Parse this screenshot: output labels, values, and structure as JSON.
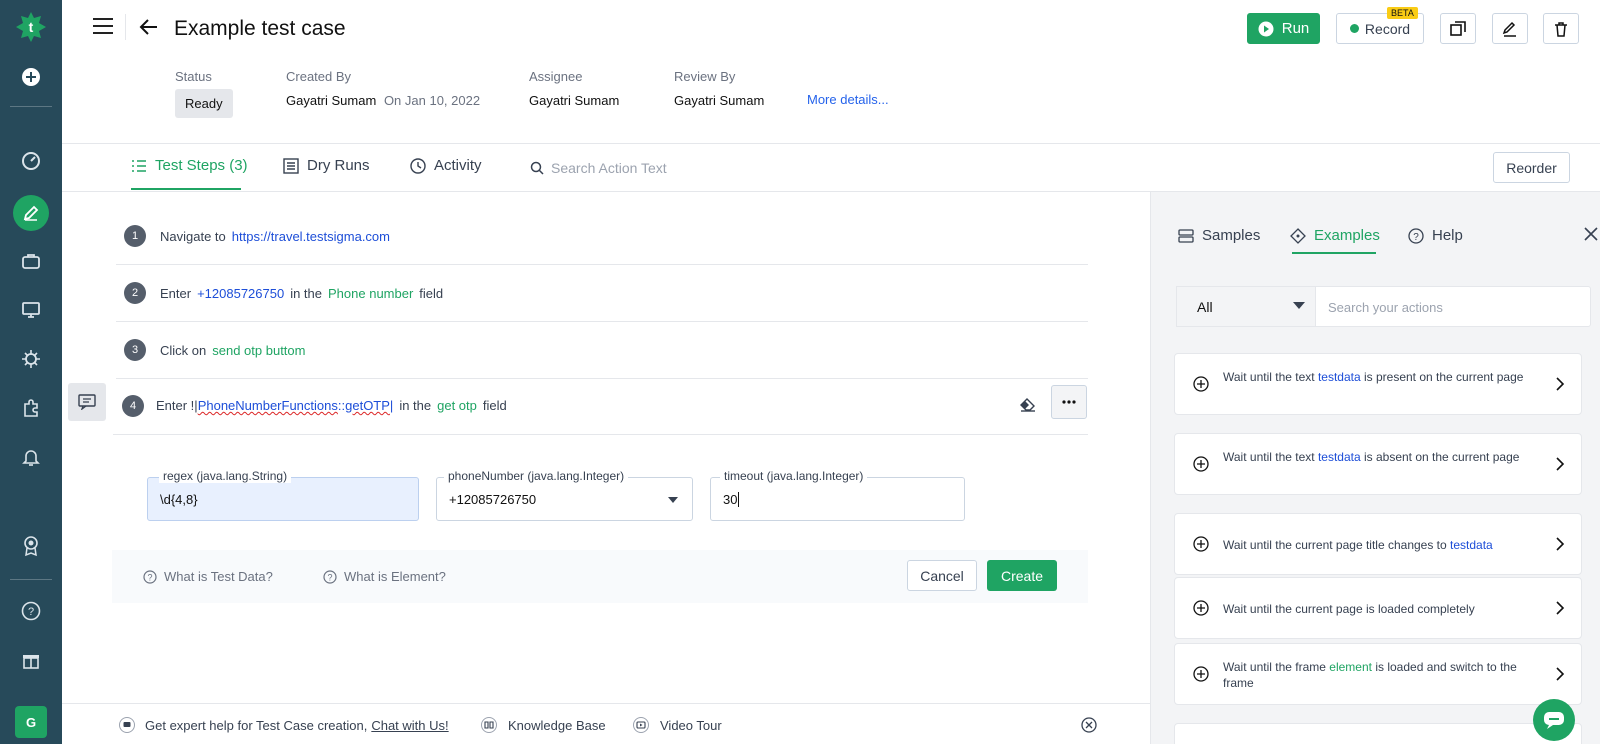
{
  "header": {
    "title": "Example test case",
    "meta": {
      "status_label": "Status",
      "status_value": "Ready",
      "created_by_label": "Created By",
      "created_by_value": "Gayatri Sumam",
      "created_on": "On Jan 10, 2022",
      "assignee_label": "Assignee",
      "assignee_value": "Gayatri Sumam",
      "review_label": "Review By",
      "review_value": "Gayatri Sumam",
      "more_details": "More details..."
    },
    "toolbar": {
      "run_label": "Run",
      "record_label": "Record",
      "beta_badge": "BETA"
    }
  },
  "tabs": {
    "steps_label": "Test Steps (3)",
    "dry_runs_label": "Dry Runs",
    "activity_label": "Activity",
    "search_placeholder": "Search Action Text",
    "reorder_label": "Reorder"
  },
  "steps": [
    {
      "num": "1",
      "parts": [
        "Navigate to",
        "https://travel.testsigma.com"
      ]
    },
    {
      "num": "2",
      "parts": [
        "Enter",
        "+12085726750",
        "in the",
        "Phone number",
        "field"
      ]
    },
    {
      "num": "3",
      "parts": [
        "Click on",
        "send otp buttom"
      ]
    },
    {
      "num": "4",
      "parts": [
        "Enter !|",
        "PhoneNumberFunctions",
        " :: ",
        "getOTP",
        "|",
        "in the",
        "get otp",
        "field"
      ]
    }
  ],
  "args": {
    "regex_label": "regex (java.lang.String)",
    "regex_value": "\\d{4,8}",
    "phone_label": "phoneNumber (java.lang.Integer)",
    "phone_value": "+12085726750",
    "timeout_label": "timeout (java.lang.Integer)",
    "timeout_value": "30"
  },
  "editor_footer": {
    "help_test_data": "What is Test Data?",
    "help_element": "What is Element?",
    "cancel_label": "Cancel",
    "create_label": "Create"
  },
  "bottom_bar": {
    "expert_help": "Get expert help for Test Case creation,",
    "chat_link": "Chat with Us!",
    "knowledge_base": "Knowledge Base",
    "video_tour": "Video Tour"
  },
  "panel": {
    "samples_label": "Samples",
    "examples_label": "Examples",
    "help_label": "Help",
    "filter_value": "All",
    "search_placeholder": "Search your actions",
    "cards": [
      {
        "pre": "Wait until the text",
        "hl": "testdata",
        "post": "is present on the current page",
        "hl_color": "blue"
      },
      {
        "pre": "Wait until the text",
        "hl": "testdata",
        "post": "is absent on the current page",
        "hl_color": "blue"
      },
      {
        "pre": "Wait until the current page title changes to",
        "hl": "testdata",
        "post": "",
        "hl_color": "blue"
      },
      {
        "pre": "Wait until the current page is loaded completely",
        "hl": "",
        "post": "",
        "hl_color": "blue"
      },
      {
        "pre": "Wait until the frame",
        "hl": "element",
        "post": "is loaded and switch to the frame",
        "hl_color": "green"
      }
    ]
  },
  "user": {
    "avatar_initial": "G"
  },
  "colors": {
    "accent": "#1fa463",
    "rail": "#274a5a",
    "link": "#1d4ed8"
  }
}
